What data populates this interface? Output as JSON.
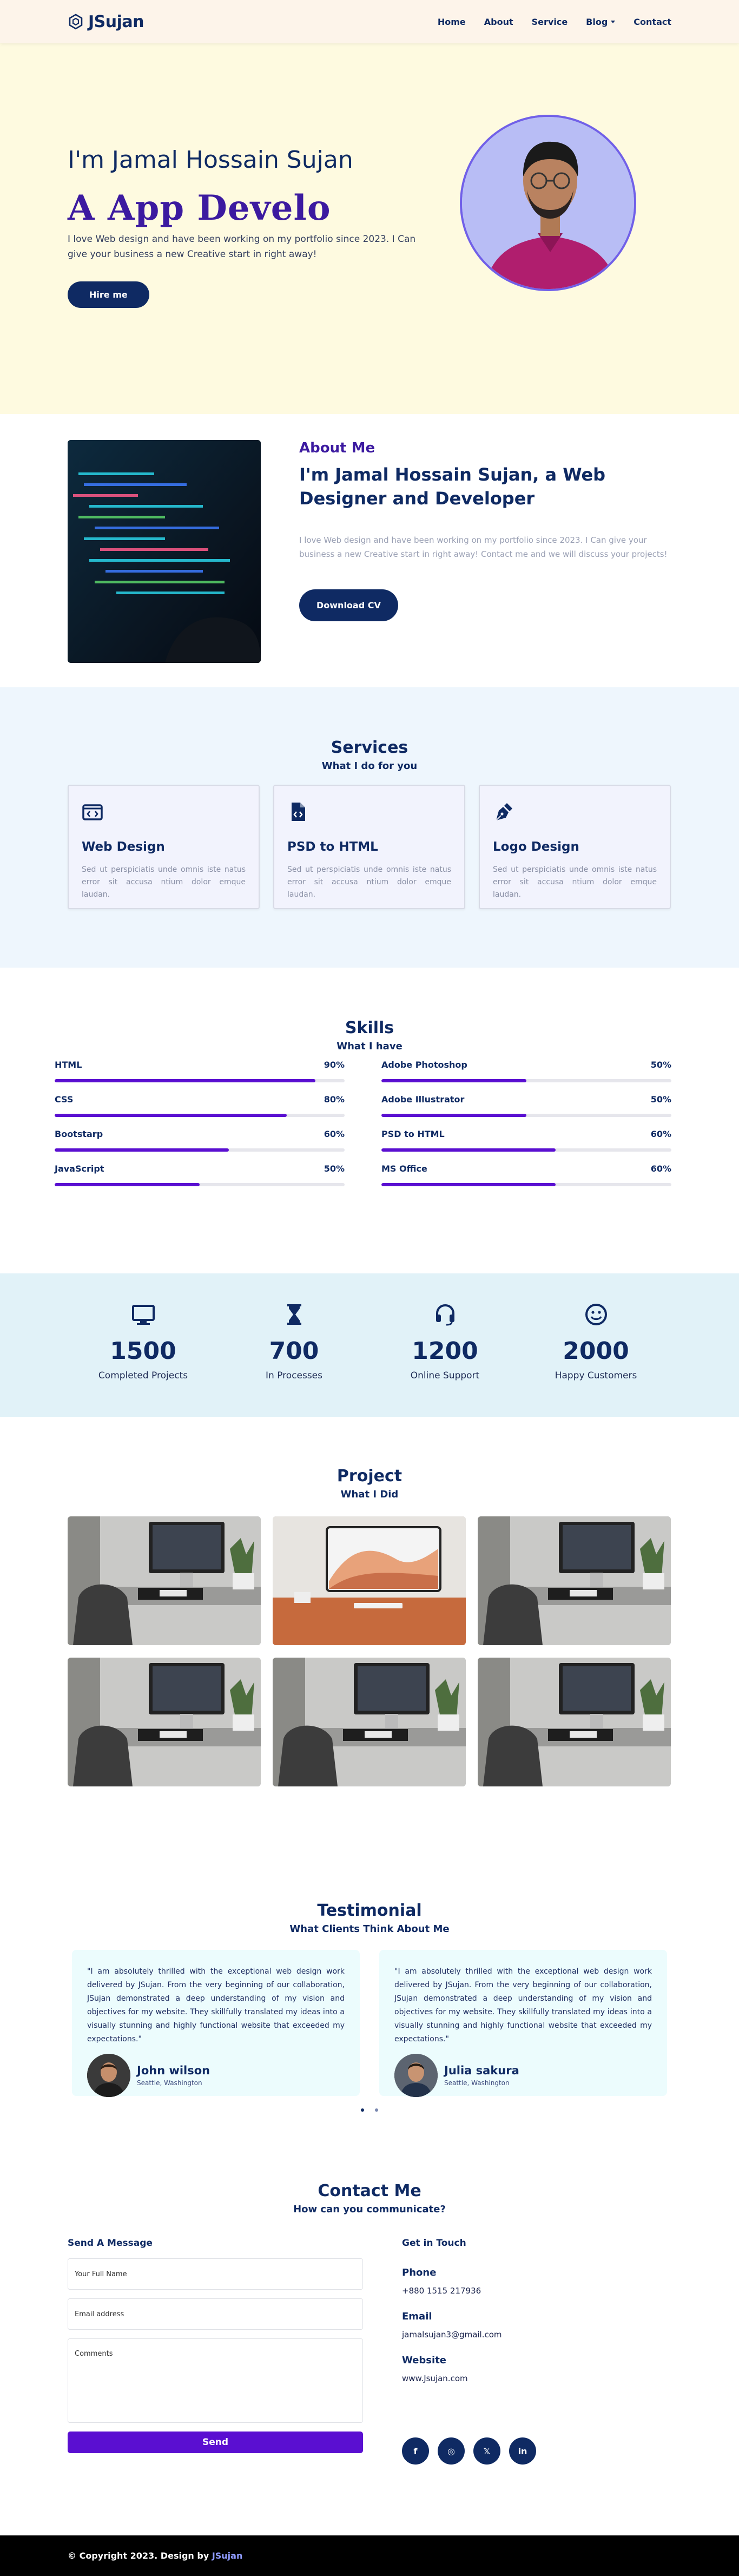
{
  "colors": {
    "primary": "#0f2a63",
    "accent": "#5a0fd1",
    "hero_bg": "#fefae0",
    "services_bg": "#eef6fd",
    "stats_bg": "#e1f2f8"
  },
  "nav": {
    "brand": "JSujan",
    "links": [
      "Home",
      "About",
      "Service",
      "Blog",
      "Contact"
    ]
  },
  "hero": {
    "greeting_prefix": "I'm ",
    "name": "Jamal Hossain Sujan",
    "role": "A App Develo",
    "description": "I love Web design and have been working on my portfolio since 2023. I Can give your business a new Creative start in right away!",
    "button": "Hire me"
  },
  "about": {
    "tag": "About Me",
    "title": "I'm Jamal Hossain Sujan, a Web Designer and Developer",
    "description": "I love Web design and have been working on my portfolio since 2023. I Can give your business a new Creative start in right away! Contact me and we will discuss your projects!",
    "button": "Download CV"
  },
  "services": {
    "title": "Services",
    "subtitle": "What I do for you",
    "items": [
      {
        "icon": "code-icon",
        "title": "Web Design",
        "desc": "Sed ut perspiciatis unde omnis iste natus error sit accusa ntium dolor emque laudan."
      },
      {
        "icon": "file-code-icon",
        "title": "PSD to HTML",
        "desc": "Sed ut perspiciatis unde omnis iste natus error sit accusa ntium dolor emque laudan."
      },
      {
        "icon": "pen-nib-icon",
        "title": "Logo Design",
        "desc": "Sed ut perspiciatis unde omnis iste natus error sit accusa ntium dolor emque laudan."
      }
    ]
  },
  "skills": {
    "title": "Skills",
    "subtitle": "What I have",
    "left": [
      {
        "name": "HTML",
        "percent": "90%",
        "value": 90
      },
      {
        "name": "CSS",
        "percent": "80%",
        "value": 80
      },
      {
        "name": "Bootstarp",
        "percent": "60%",
        "value": 60
      },
      {
        "name": "JavaScript",
        "percent": "50%",
        "value": 50
      }
    ],
    "right": [
      {
        "name": "Adobe Photoshop",
        "percent": "50%",
        "value": 50
      },
      {
        "name": "Adobe Illustrator",
        "percent": "50%",
        "value": 50
      },
      {
        "name": "PSD to HTML",
        "percent": "60%",
        "value": 60
      },
      {
        "name": "MS Office",
        "percent": "60%",
        "value": 60
      }
    ]
  },
  "stats": [
    {
      "icon": "monitor-icon",
      "num": "1500",
      "label": "Completed Projects"
    },
    {
      "icon": "hourglass-icon",
      "num": "700",
      "label": "In Processes"
    },
    {
      "icon": "headset-icon",
      "num": "1200",
      "label": "Online Support"
    },
    {
      "icon": "smile-icon",
      "num": "2000",
      "label": "Happy Customers"
    }
  ],
  "projects": {
    "title": "Project",
    "subtitle": "What I Did"
  },
  "testimonials": {
    "title": "Testimonial",
    "subtitle": "What Clients Think About Me",
    "items": [
      {
        "quote": "\"I am absolutely thrilled with the exceptional web design work delivered by JSujan. From the very beginning of our collaboration, JSujan demonstrated a deep understanding of my vision and objectives for my website. They skillfully translated my ideas into a visually stunning and highly functional website that exceeded my expectations.\"",
        "name": "John wilson",
        "location": "Seattle, Washington"
      },
      {
        "quote": "\"I am absolutely thrilled with the exceptional web design work delivered by JSujan. From the very beginning of our collaboration, JSujan demonstrated a deep understanding of my vision and objectives for my website. They skillfully translated my ideas into a visually stunning and highly functional website that exceeded my expectations.\"",
        "name": "Julia sakura",
        "location": "Seattle, Washington"
      }
    ]
  },
  "contact": {
    "title": "Contact Me",
    "subtitle": "How can you communicate?",
    "form_label": "Send A Message",
    "name_placeholder": "Your Full Name",
    "email_placeholder": "Email address",
    "comments_placeholder": "Comments",
    "send": "Send",
    "info_head": "Get in Touch",
    "phone_key": "Phone",
    "phone": "+880 1515 217936",
    "email_key": "Email",
    "email": "jamalsujan3@gmail.com",
    "website_key": "Website",
    "website": "www.Jsujan.com",
    "socials": [
      "f",
      "◎",
      "𝕏",
      "in"
    ]
  },
  "footer": {
    "text": "© Copyright 2023. Design by ",
    "link": "JSujan"
  }
}
